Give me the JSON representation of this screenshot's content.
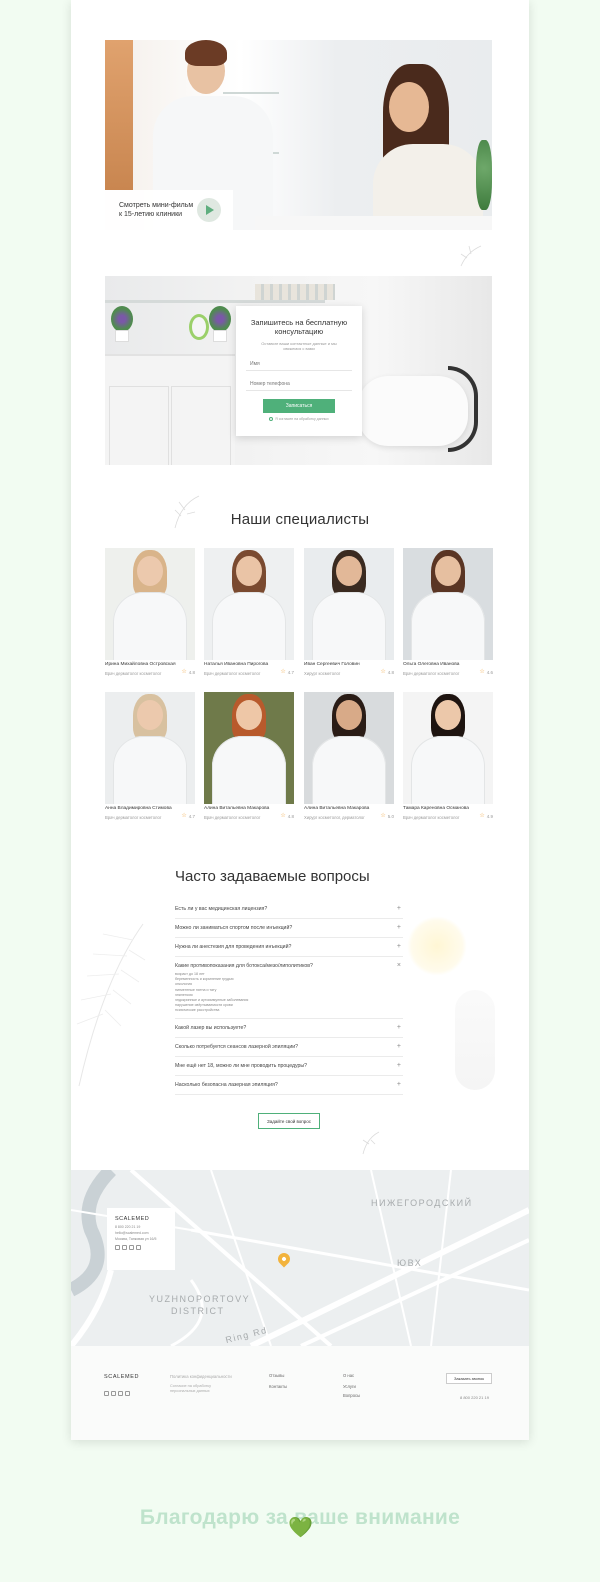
{
  "hero": {
    "film_label": "Смотреть мини-фильм к 15-летию клиники"
  },
  "consultation": {
    "title": "Запишитесь на бесплатную консультацию",
    "subtitle": "Оставьте ваши контактные данные и мы свяжемся с вами",
    "name_placeholder": "Имя",
    "phone_placeholder": "Номер телефона",
    "submit_label": "Записаться",
    "consent": "Я согласен на обработку данных"
  },
  "specialists": {
    "title": "Наши специалисты",
    "items": [
      {
        "name": "Ирина Михайловна Островская",
        "role": "Врач дерматолог косметолог",
        "rating": "4.8"
      },
      {
        "name": "Наталья Ивановна Пирогова",
        "role": "Врач дерматолог косметолог",
        "rating": "4.7"
      },
      {
        "name": "Иван Сергеевич Головин",
        "role": "Хирург косметолог",
        "rating": "4.8"
      },
      {
        "name": "Ольга Олеговна Иванова",
        "role": "Врач дерматолог косметолог",
        "rating": "4.6"
      },
      {
        "name": "Анна Владимировна Стимова",
        "role": "Врач дерматолог косметолог",
        "rating": "4.7"
      },
      {
        "name": "Алина Витальевна Макарова",
        "role": "Врач дерматолог косметолог",
        "rating": "4.8"
      },
      {
        "name": "Алина Витальевна Макарова",
        "role": "Хирург косметолог, дерматолог",
        "rating": "5.0"
      },
      {
        "name": "Тамара Кареновна Османова",
        "role": "Врач дерматолог косметолог",
        "rating": "4.9"
      }
    ]
  },
  "faq": {
    "title": "Часто задаваемые вопросы",
    "items": [
      {
        "q": "Есть ли у вас медицинская лицензия?",
        "toggle": "+"
      },
      {
        "q": "Можно ли заниматься спортом после инъекций?",
        "toggle": "+"
      },
      {
        "q": "Нужна ли анестезия для проведения инъекций?",
        "toggle": "+"
      },
      {
        "q": "Какие противопоказания для ботокса/мезо/липолитиков?",
        "toggle": "×",
        "answer": [
          "возраст до 18 лет",
          "беременность и кормление грудью",
          "онкология",
          "пигментные пятна и тату",
          "эпилепсия",
          "эндокринные и аутоиммунные заболевания",
          "нарушение свёртываемости крови",
          "психические расстройства"
        ]
      },
      {
        "q": "Какой лазер вы используете?",
        "toggle": "+"
      },
      {
        "q": "Сколько потребуется сеансов лазерной эпиляции?",
        "toggle": "+"
      },
      {
        "q": "Мне ещё нет 18, можно ли мне проводить процедуры?",
        "toggle": "+"
      },
      {
        "q": "Насколько безопасна лазерная эпиляция?",
        "toggle": "+"
      }
    ],
    "ask_label": "Задайте свой вопрос"
  },
  "map": {
    "brand": "SCALEMED",
    "phone": "8 800 220 21 19",
    "email": "hello@scalemed.com",
    "address": "Москва, Танковая ул 16/5",
    "labels": {
      "district_ne": "НИЖЕГОРОДСКИЙ",
      "road": "ЮВХ",
      "district_sw_1": "YUZHNOPORTOVY",
      "district_sw_2": "DISTRICT",
      "street": "Ring Rd"
    }
  },
  "footer": {
    "brand": "SCALEMED",
    "privacy": "Политика конфиденциальности",
    "consent_text": "Согласие на обработку персональных данных",
    "links": [
      "Отзывы",
      "Контакты",
      "О нас",
      "Услуги",
      "Вопросы"
    ],
    "call_label": "Заказать звонок",
    "phone": "8 800 220 21 19"
  },
  "thanks": {
    "text": "Благодарю за ваше внимание",
    "icon": "💚"
  },
  "colors": {
    "accent": "#4fb07a",
    "star": "#f0a43c",
    "pin": "#f2b33d",
    "outer_bg": "#f2fcf2"
  }
}
